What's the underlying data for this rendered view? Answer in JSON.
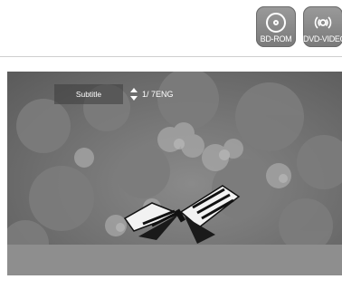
{
  "badges": [
    {
      "label": "BD-ROM",
      "icon": "bd-disc-icon"
    },
    {
      "label": "DVD-VIDEO",
      "icon": "dvd-disc-icon"
    }
  ],
  "osd": {
    "label": "Subtitle",
    "value": "1/ 7ENG",
    "icon": "up-down-arrows-icon"
  }
}
